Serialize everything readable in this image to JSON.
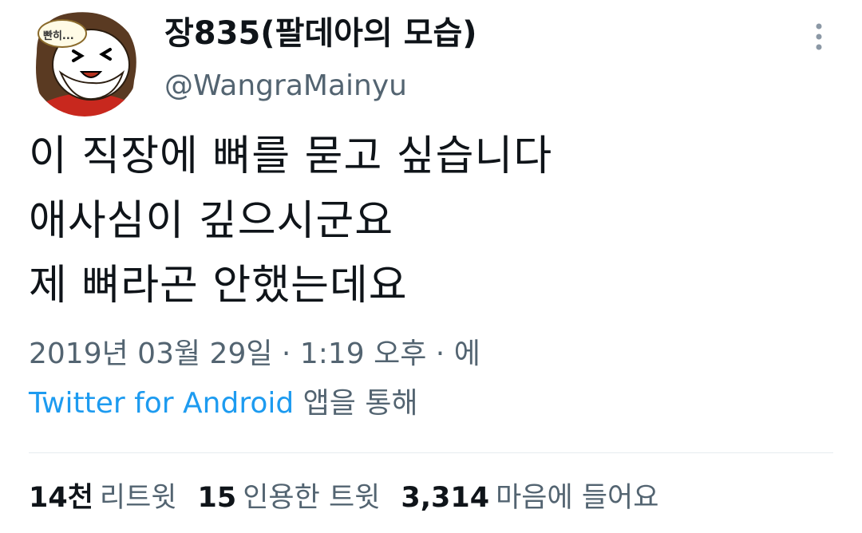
{
  "author": {
    "display_name": "장835(팔데아의 모습)",
    "handle": "@WangraMainyu",
    "avatar_caption": "빤히..."
  },
  "tweet": {
    "lines": [
      "이 직장에 뼈를 묻고 싶습니다",
      "애사심이 깊으시군요",
      "제 뼈라곤 안했는데요"
    ]
  },
  "meta": {
    "date": "2019년 03월 29일",
    "separator1": " · ",
    "time": "1:19 오후",
    "separator2": " · ",
    "suffix": "에",
    "source_app": "Twitter for Android",
    "source_suffix": " 앱을 통해"
  },
  "stats": {
    "retweets_count": "14천",
    "retweets_label": "리트윗",
    "quotes_count": "15",
    "quotes_label": "인용한 트윗",
    "likes_count": "3,314",
    "likes_label": "마음에 들어요"
  },
  "colors": {
    "text_primary": "#0f1419",
    "text_secondary": "#536471",
    "link": "#1d9bf0",
    "divider": "#e6ecf0"
  },
  "icons": {
    "more": "more-vertical-icon"
  }
}
